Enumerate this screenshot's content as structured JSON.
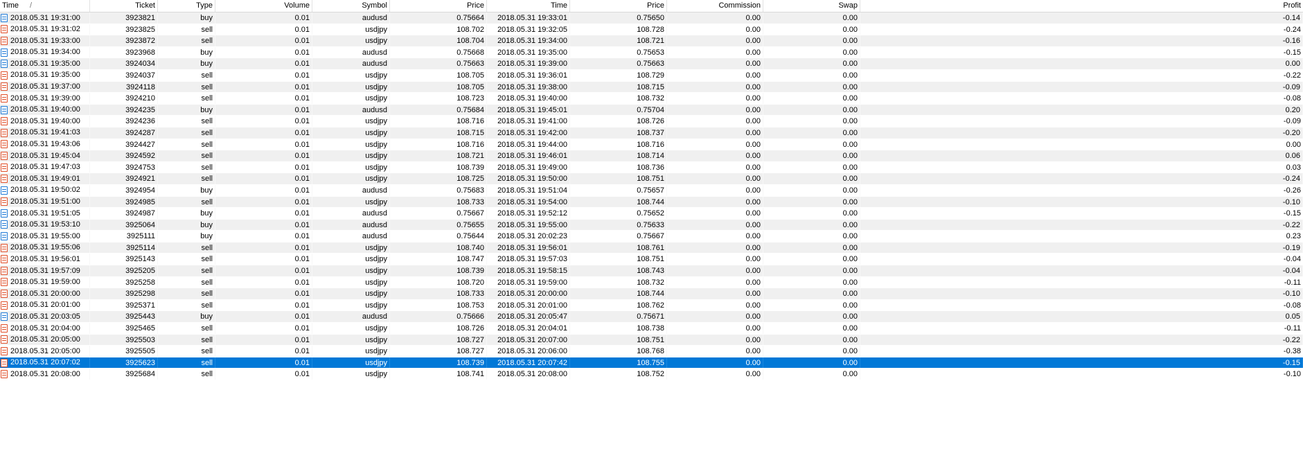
{
  "columns": {
    "open_time": "Time",
    "sort_indicator": "/",
    "ticket": "Ticket",
    "type": "Type",
    "volume": "Volume",
    "symbol": "Symbol",
    "open_price": "Price",
    "close_time": "Time",
    "close_price": "Price",
    "commission": "Commission",
    "swap": "Swap",
    "profit": "Profit"
  },
  "colors": {
    "selection": "#0078d7",
    "buy_icon": "#1f7ad6",
    "sell_icon": "#e0502a",
    "stripe": "#f0f0f0"
  },
  "selected_index": 30,
  "rows": [
    {
      "open_time": "2018.05.31 19:31:00",
      "ticket": "3923821",
      "type": "buy",
      "volume": "0.01",
      "symbol": "audusd",
      "open_price": "0.75664",
      "close_time": "2018.05.31 19:33:01",
      "close_price": "0.75650",
      "commission": "0.00",
      "swap": "0.00",
      "profit": "-0.14"
    },
    {
      "open_time": "2018.05.31 19:31:02",
      "ticket": "3923825",
      "type": "sell",
      "volume": "0.01",
      "symbol": "usdjpy",
      "open_price": "108.702",
      "close_time": "2018.05.31 19:32:05",
      "close_price": "108.728",
      "commission": "0.00",
      "swap": "0.00",
      "profit": "-0.24"
    },
    {
      "open_time": "2018.05.31 19:33:00",
      "ticket": "3923872",
      "type": "sell",
      "volume": "0.01",
      "symbol": "usdjpy",
      "open_price": "108.704",
      "close_time": "2018.05.31 19:34:00",
      "close_price": "108.721",
      "commission": "0.00",
      "swap": "0.00",
      "profit": "-0.16"
    },
    {
      "open_time": "2018.05.31 19:34:00",
      "ticket": "3923968",
      "type": "buy",
      "volume": "0.01",
      "symbol": "audusd",
      "open_price": "0.75668",
      "close_time": "2018.05.31 19:35:00",
      "close_price": "0.75653",
      "commission": "0.00",
      "swap": "0.00",
      "profit": "-0.15"
    },
    {
      "open_time": "2018.05.31 19:35:00",
      "ticket": "3924034",
      "type": "buy",
      "volume": "0.01",
      "symbol": "audusd",
      "open_price": "0.75663",
      "close_time": "2018.05.31 19:39:00",
      "close_price": "0.75663",
      "commission": "0.00",
      "swap": "0.00",
      "profit": "0.00"
    },
    {
      "open_time": "2018.05.31 19:35:00",
      "ticket": "3924037",
      "type": "sell",
      "volume": "0.01",
      "symbol": "usdjpy",
      "open_price": "108.705",
      "close_time": "2018.05.31 19:36:01",
      "close_price": "108.729",
      "commission": "0.00",
      "swap": "0.00",
      "profit": "-0.22"
    },
    {
      "open_time": "2018.05.31 19:37:00",
      "ticket": "3924118",
      "type": "sell",
      "volume": "0.01",
      "symbol": "usdjpy",
      "open_price": "108.705",
      "close_time": "2018.05.31 19:38:00",
      "close_price": "108.715",
      "commission": "0.00",
      "swap": "0.00",
      "profit": "-0.09"
    },
    {
      "open_time": "2018.05.31 19:39:00",
      "ticket": "3924210",
      "type": "sell",
      "volume": "0.01",
      "symbol": "usdjpy",
      "open_price": "108.723",
      "close_time": "2018.05.31 19:40:00",
      "close_price": "108.732",
      "commission": "0.00",
      "swap": "0.00",
      "profit": "-0.08"
    },
    {
      "open_time": "2018.05.31 19:40:00",
      "ticket": "3924235",
      "type": "buy",
      "volume": "0.01",
      "symbol": "audusd",
      "open_price": "0.75684",
      "close_time": "2018.05.31 19:45:01",
      "close_price": "0.75704",
      "commission": "0.00",
      "swap": "0.00",
      "profit": "0.20"
    },
    {
      "open_time": "2018.05.31 19:40:00",
      "ticket": "3924236",
      "type": "sell",
      "volume": "0.01",
      "symbol": "usdjpy",
      "open_price": "108.716",
      "close_time": "2018.05.31 19:41:00",
      "close_price": "108.726",
      "commission": "0.00",
      "swap": "0.00",
      "profit": "-0.09"
    },
    {
      "open_time": "2018.05.31 19:41:03",
      "ticket": "3924287",
      "type": "sell",
      "volume": "0.01",
      "symbol": "usdjpy",
      "open_price": "108.715",
      "close_time": "2018.05.31 19:42:00",
      "close_price": "108.737",
      "commission": "0.00",
      "swap": "0.00",
      "profit": "-0.20"
    },
    {
      "open_time": "2018.05.31 19:43:06",
      "ticket": "3924427",
      "type": "sell",
      "volume": "0.01",
      "symbol": "usdjpy",
      "open_price": "108.716",
      "close_time": "2018.05.31 19:44:00",
      "close_price": "108.716",
      "commission": "0.00",
      "swap": "0.00",
      "profit": "0.00"
    },
    {
      "open_time": "2018.05.31 19:45:04",
      "ticket": "3924592",
      "type": "sell",
      "volume": "0.01",
      "symbol": "usdjpy",
      "open_price": "108.721",
      "close_time": "2018.05.31 19:46:01",
      "close_price": "108.714",
      "commission": "0.00",
      "swap": "0.00",
      "profit": "0.06"
    },
    {
      "open_time": "2018.05.31 19:47:03",
      "ticket": "3924753",
      "type": "sell",
      "volume": "0.01",
      "symbol": "usdjpy",
      "open_price": "108.739",
      "close_time": "2018.05.31 19:49:00",
      "close_price": "108.736",
      "commission": "0.00",
      "swap": "0.00",
      "profit": "0.03"
    },
    {
      "open_time": "2018.05.31 19:49:01",
      "ticket": "3924921",
      "type": "sell",
      "volume": "0.01",
      "symbol": "usdjpy",
      "open_price": "108.725",
      "close_time": "2018.05.31 19:50:00",
      "close_price": "108.751",
      "commission": "0.00",
      "swap": "0.00",
      "profit": "-0.24"
    },
    {
      "open_time": "2018.05.31 19:50:02",
      "ticket": "3924954",
      "type": "buy",
      "volume": "0.01",
      "symbol": "audusd",
      "open_price": "0.75683",
      "close_time": "2018.05.31 19:51:04",
      "close_price": "0.75657",
      "commission": "0.00",
      "swap": "0.00",
      "profit": "-0.26"
    },
    {
      "open_time": "2018.05.31 19:51:00",
      "ticket": "3924985",
      "type": "sell",
      "volume": "0.01",
      "symbol": "usdjpy",
      "open_price": "108.733",
      "close_time": "2018.05.31 19:54:00",
      "close_price": "108.744",
      "commission": "0.00",
      "swap": "0.00",
      "profit": "-0.10"
    },
    {
      "open_time": "2018.05.31 19:51:05",
      "ticket": "3924987",
      "type": "buy",
      "volume": "0.01",
      "symbol": "audusd",
      "open_price": "0.75667",
      "close_time": "2018.05.31 19:52:12",
      "close_price": "0.75652",
      "commission": "0.00",
      "swap": "0.00",
      "profit": "-0.15"
    },
    {
      "open_time": "2018.05.31 19:53:10",
      "ticket": "3925064",
      "type": "buy",
      "volume": "0.01",
      "symbol": "audusd",
      "open_price": "0.75655",
      "close_time": "2018.05.31 19:55:00",
      "close_price": "0.75633",
      "commission": "0.00",
      "swap": "0.00",
      "profit": "-0.22"
    },
    {
      "open_time": "2018.05.31 19:55:00",
      "ticket": "3925111",
      "type": "buy",
      "volume": "0.01",
      "symbol": "audusd",
      "open_price": "0.75644",
      "close_time": "2018.05.31 20:02:23",
      "close_price": "0.75667",
      "commission": "0.00",
      "swap": "0.00",
      "profit": "0.23"
    },
    {
      "open_time": "2018.05.31 19:55:06",
      "ticket": "3925114",
      "type": "sell",
      "volume": "0.01",
      "symbol": "usdjpy",
      "open_price": "108.740",
      "close_time": "2018.05.31 19:56:01",
      "close_price": "108.761",
      "commission": "0.00",
      "swap": "0.00",
      "profit": "-0.19"
    },
    {
      "open_time": "2018.05.31 19:56:01",
      "ticket": "3925143",
      "type": "sell",
      "volume": "0.01",
      "symbol": "usdjpy",
      "open_price": "108.747",
      "close_time": "2018.05.31 19:57:03",
      "close_price": "108.751",
      "commission": "0.00",
      "swap": "0.00",
      "profit": "-0.04"
    },
    {
      "open_time": "2018.05.31 19:57:09",
      "ticket": "3925205",
      "type": "sell",
      "volume": "0.01",
      "symbol": "usdjpy",
      "open_price": "108.739",
      "close_time": "2018.05.31 19:58:15",
      "close_price": "108.743",
      "commission": "0.00",
      "swap": "0.00",
      "profit": "-0.04"
    },
    {
      "open_time": "2018.05.31 19:59:00",
      "ticket": "3925258",
      "type": "sell",
      "volume": "0.01",
      "symbol": "usdjpy",
      "open_price": "108.720",
      "close_time": "2018.05.31 19:59:00",
      "close_price": "108.732",
      "commission": "0.00",
      "swap": "0.00",
      "profit": "-0.11"
    },
    {
      "open_time": "2018.05.31 20:00:00",
      "ticket": "3925298",
      "type": "sell",
      "volume": "0.01",
      "symbol": "usdjpy",
      "open_price": "108.733",
      "close_time": "2018.05.31 20:00:00",
      "close_price": "108.744",
      "commission": "0.00",
      "swap": "0.00",
      "profit": "-0.10"
    },
    {
      "open_time": "2018.05.31 20:01:00",
      "ticket": "3925371",
      "type": "sell",
      "volume": "0.01",
      "symbol": "usdjpy",
      "open_price": "108.753",
      "close_time": "2018.05.31 20:01:00",
      "close_price": "108.762",
      "commission": "0.00",
      "swap": "0.00",
      "profit": "-0.08"
    },
    {
      "open_time": "2018.05.31 20:03:05",
      "ticket": "3925443",
      "type": "buy",
      "volume": "0.01",
      "symbol": "audusd",
      "open_price": "0.75666",
      "close_time": "2018.05.31 20:05:47",
      "close_price": "0.75671",
      "commission": "0.00",
      "swap": "0.00",
      "profit": "0.05"
    },
    {
      "open_time": "2018.05.31 20:04:00",
      "ticket": "3925465",
      "type": "sell",
      "volume": "0.01",
      "symbol": "usdjpy",
      "open_price": "108.726",
      "close_time": "2018.05.31 20:04:01",
      "close_price": "108.738",
      "commission": "0.00",
      "swap": "0.00",
      "profit": "-0.11"
    },
    {
      "open_time": "2018.05.31 20:05:00",
      "ticket": "3925503",
      "type": "sell",
      "volume": "0.01",
      "symbol": "usdjpy",
      "open_price": "108.727",
      "close_time": "2018.05.31 20:07:00",
      "close_price": "108.751",
      "commission": "0.00",
      "swap": "0.00",
      "profit": "-0.22"
    },
    {
      "open_time": "2018.05.31 20:05:00",
      "ticket": "3925505",
      "type": "sell",
      "volume": "0.01",
      "symbol": "usdjpy",
      "open_price": "108.727",
      "close_time": "2018.05.31 20:06:00",
      "close_price": "108.768",
      "commission": "0.00",
      "swap": "0.00",
      "profit": "-0.38"
    },
    {
      "open_time": "2018.05.31 20:07:02",
      "ticket": "3925623",
      "type": "sell",
      "volume": "0.01",
      "symbol": "usdjpy",
      "open_price": "108.739",
      "close_time": "2018.05.31 20:07:42",
      "close_price": "108.755",
      "commission": "0.00",
      "swap": "0.00",
      "profit": "-0.15"
    },
    {
      "open_time": "2018.05.31 20:08:00",
      "ticket": "3925684",
      "type": "sell",
      "volume": "0.01",
      "symbol": "usdjpy",
      "open_price": "108.741",
      "close_time": "2018.05.31 20:08:00",
      "close_price": "108.752",
      "commission": "0.00",
      "swap": "0.00",
      "profit": "-0.10"
    }
  ]
}
